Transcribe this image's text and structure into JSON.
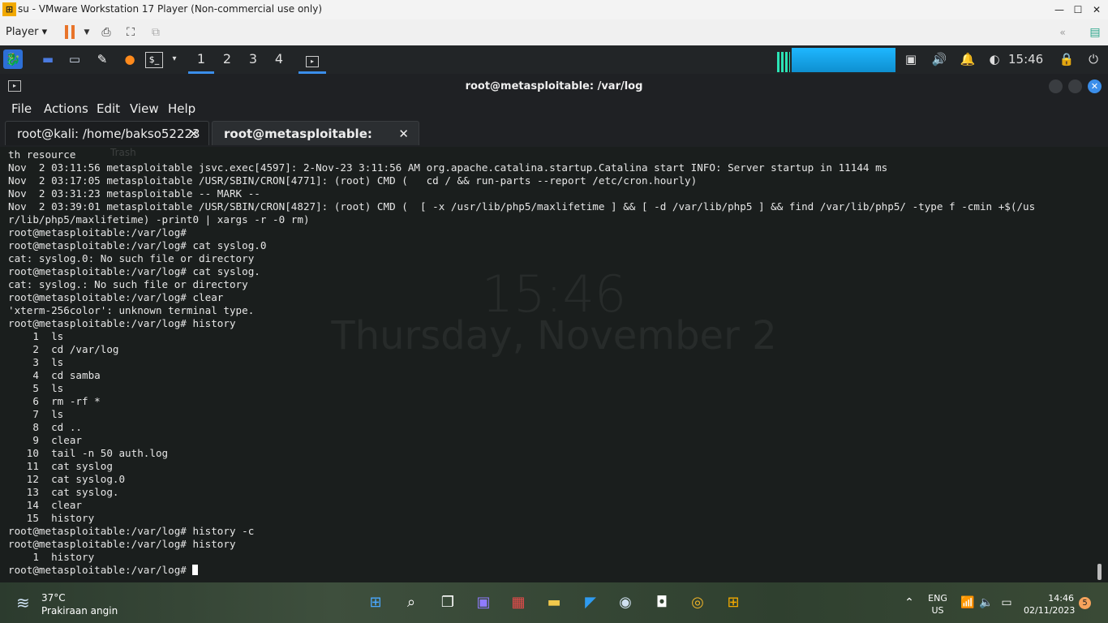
{
  "vmware": {
    "title": "su - VMware Workstation 17 Player (Non-commercial use only)",
    "player_label": "Player"
  },
  "panel": {
    "workspaces": [
      "1",
      "2",
      "3",
      "4"
    ],
    "active_workspace": "1",
    "clock": "15:46"
  },
  "terminal": {
    "window_title": "root@metasploitable: /var/log",
    "menu": [
      "File",
      "Actions",
      "Edit",
      "View",
      "Help"
    ],
    "tabs": [
      {
        "label": "root@kali: /home/bakso52223",
        "close": "✕",
        "active": false
      },
      {
        "label": "root@metasploitable: /var/log",
        "close": "✕",
        "active": true
      }
    ],
    "lines": [
      "th resource",
      "Nov  2 03:11:56 metasploitable jsvc.exec[4597]: 2-Nov-23 3:11:56 AM org.apache.catalina.startup.Catalina start INFO: Server startup in 11144 ms",
      "Nov  2 03:17:05 metasploitable /USR/SBIN/CRON[4771]: (root) CMD (   cd / && run-parts --report /etc/cron.hourly)",
      "Nov  2 03:31:23 metasploitable -- MARK --",
      "Nov  2 03:39:01 metasploitable /USR/SBIN/CRON[4827]: (root) CMD (  [ -x /usr/lib/php5/maxlifetime ] && [ -d /var/lib/php5 ] && find /var/lib/php5/ -type f -cmin +$(/us",
      "r/lib/php5/maxlifetime) -print0 | xargs -r -0 rm)",
      "root@metasploitable:/var/log#",
      "root@metasploitable:/var/log# cat syslog.0",
      "cat: syslog.0: No such file or directory",
      "root@metasploitable:/var/log# cat syslog.",
      "cat: syslog.: No such file or directory",
      "root@metasploitable:/var/log# clear",
      "'xterm-256color': unknown terminal type.",
      "root@metasploitable:/var/log# history",
      "    1  ls",
      "    2  cd /var/log",
      "    3  ls",
      "    4  cd samba",
      "    5  ls",
      "    6  rm -rf *",
      "    7  ls",
      "    8  cd ..",
      "    9  clear",
      "   10  tail -n 50 auth.log",
      "   11  cat syslog",
      "   12  cat syslog.0",
      "   13  cat syslog.",
      "   14  clear",
      "   15  history",
      "root@metasploitable:/var/log# history -c",
      "root@metasploitable:/var/log# history",
      "    1  history"
    ],
    "prompt": "root@metasploitable:/var/log# ",
    "background_clock": "15:46",
    "background_date": "Thursday, November   2",
    "desktop_label": "Trash"
  },
  "taskbar": {
    "weather_temp": "37°C",
    "weather_desc": "Prakiraan angin",
    "lang_line1": "ENG",
    "lang_line2": "US",
    "time": "14:46",
    "date": "02/11/2023",
    "notification_count": "5"
  },
  "colors": {
    "accent": "#3b8eea",
    "terminal_bg": "#1a1e1d",
    "cpu_graph": "#1fb7ff"
  }
}
